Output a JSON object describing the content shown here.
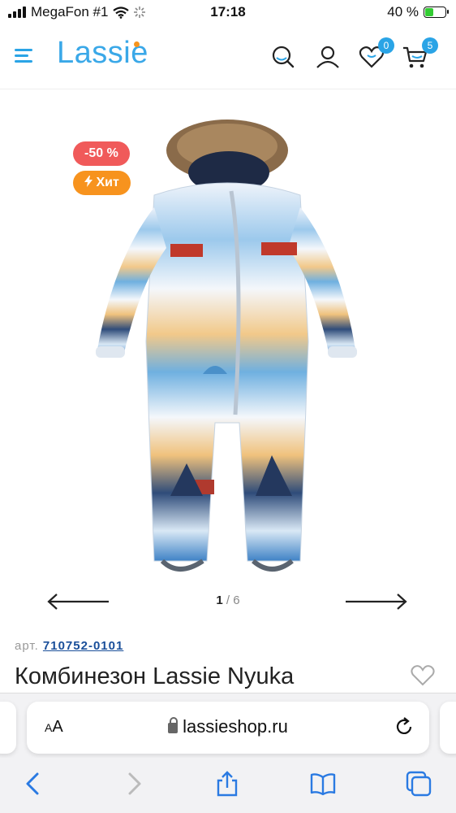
{
  "status": {
    "carrier": "MegaFon #1",
    "time": "17:18",
    "battery": "40 %"
  },
  "header": {
    "logo": "Lassie",
    "favorites_count": "0",
    "cart_count": "5"
  },
  "product": {
    "badges": {
      "sale": "-50 %",
      "hit": "Хит"
    },
    "pager": {
      "current": "1",
      "separator": "/",
      "total": "6"
    },
    "sku_label": "арт.",
    "sku": "710752-0101",
    "title": "Комбинезон Lassie Nyuka"
  },
  "browser": {
    "aa_small": "A",
    "aa_big": "A",
    "url": "lassieshop.ru"
  },
  "colors": {
    "brand": "#2aa4e6",
    "sale": "#f05a5a",
    "hit": "#f7931e",
    "link": "#1a4f9a"
  }
}
